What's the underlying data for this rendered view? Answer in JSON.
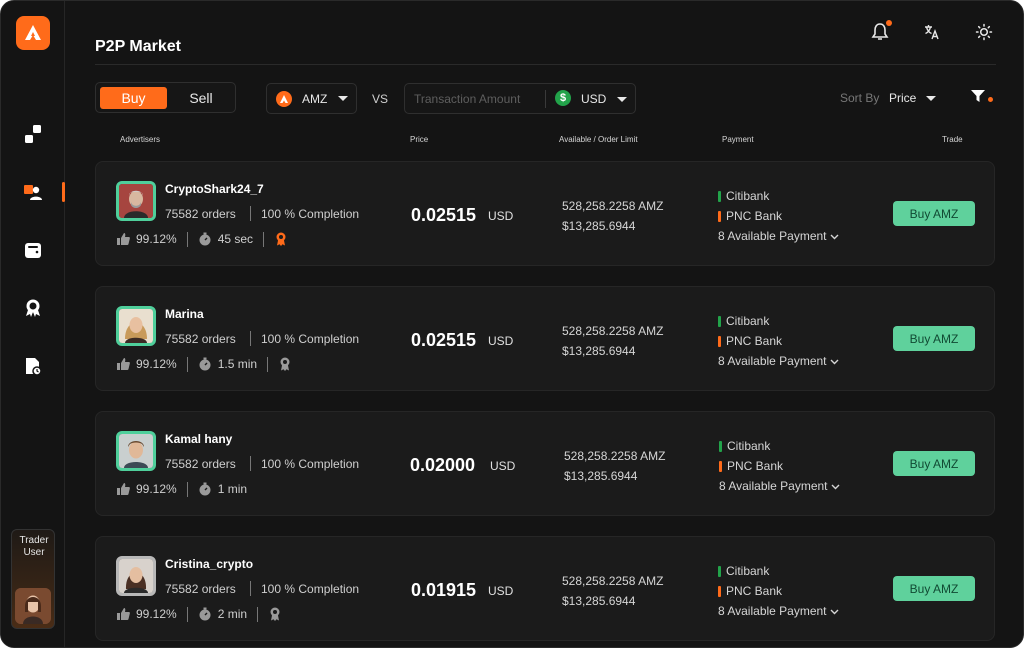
{
  "header": {
    "title": "P2P Market"
  },
  "sidebar": {
    "trader_label": "Trader User"
  },
  "toolbar": {
    "buy_label": "Buy",
    "sell_label": "Sell",
    "coin": "AMZ",
    "vs_label": "VS",
    "amount_placeholder": "Transaction Amount",
    "fiat": "USD",
    "sort_label": "Sort By",
    "sort_value": "Price"
  },
  "columns": {
    "advertisers": "Advertisers",
    "price": "Price",
    "available": "Available / Order Limit",
    "payment": "Payment",
    "trade": "Trade"
  },
  "colors": {
    "accent": "#ff6b1a",
    "success": "#5fd19c",
    "citibank": "#22a34a",
    "pnc": "#ff6b1a"
  },
  "rows": [
    {
      "name": "CryptoShark24_7",
      "orders": "75582 orders",
      "completion": "100 % Completion",
      "rating": "99.12%",
      "time": "45 sec",
      "price": "0.02515",
      "currency": "USD",
      "available": "528,258.2258 AMZ",
      "limit": "$13,285.6944",
      "payment1": "Citibank",
      "payment2": "PNC Bank",
      "more_payment": "8 Available Payment",
      "action": "Buy AMZ"
    },
    {
      "name": "Marina",
      "orders": "75582 orders",
      "completion": "100 % Completion",
      "rating": "99.12%",
      "time": "1.5 min",
      "price": "0.02515",
      "currency": "USD",
      "available": "528,258.2258 AMZ",
      "limit": "$13,285.6944",
      "payment1": "Citibank",
      "payment2": "PNC Bank",
      "more_payment": "8 Available Payment",
      "action": "Buy AMZ"
    },
    {
      "name": "Kamal hany",
      "orders": "75582 orders",
      "completion": "100 % Completion",
      "rating": "99.12%",
      "time": "1 min",
      "price": "0.02000",
      "currency": "USD",
      "available": "528,258.2258 AMZ",
      "limit": "$13,285.6944",
      "payment1": "Citibank",
      "payment2": "PNC Bank",
      "more_payment": "8 Available Payment",
      "action": "Buy AMZ"
    },
    {
      "name": "Cristina_crypto",
      "orders": "75582 orders",
      "completion": "100 % Completion",
      "rating": "99.12%",
      "time": "2 min",
      "price": "0.01915",
      "currency": "USD",
      "available": "528,258.2258 AMZ",
      "limit": "$13,285.6944",
      "payment1": "Citibank",
      "payment2": "PNC Bank",
      "more_payment": "8 Available Payment",
      "action": "Buy AMZ"
    }
  ]
}
